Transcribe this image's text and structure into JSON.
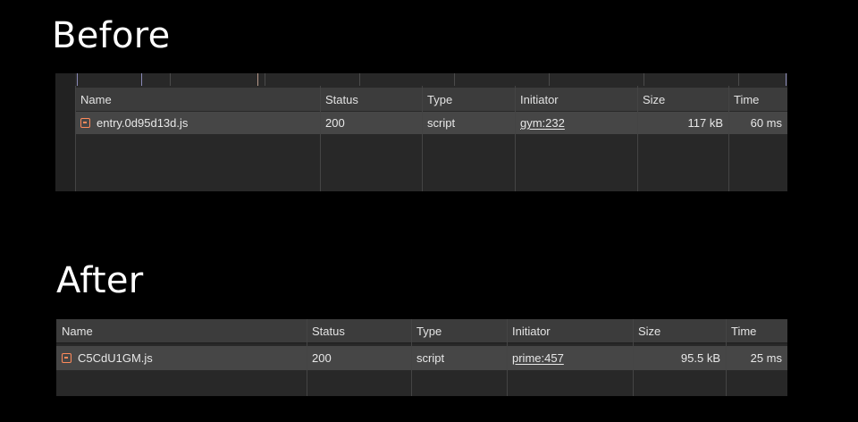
{
  "before": {
    "heading": "Before",
    "columns": [
      "Name",
      "Status",
      "Type",
      "Initiator",
      "Size",
      "Time"
    ],
    "row": {
      "name": "entry.0d95d13d.js",
      "status": "200",
      "type": "script",
      "initiator": "gym:232",
      "size": "117 kB",
      "time": "60 ms",
      "icon": "script-file-icon"
    }
  },
  "after": {
    "heading": "After",
    "columns": [
      "Name",
      "Status",
      "Type",
      "Initiator",
      "Size",
      "Time"
    ],
    "row": {
      "name": "C5CdU1GM.js",
      "status": "200",
      "type": "script",
      "initiator": "prime:457",
      "size": "95.5 kB",
      "time": "25 ms",
      "icon": "script-file-icon"
    }
  },
  "colors": {
    "background": "#000000",
    "panel": "#282828",
    "header": "#3c3c3c",
    "selected_row": "#464646",
    "script_icon": "#ff8a5b"
  }
}
